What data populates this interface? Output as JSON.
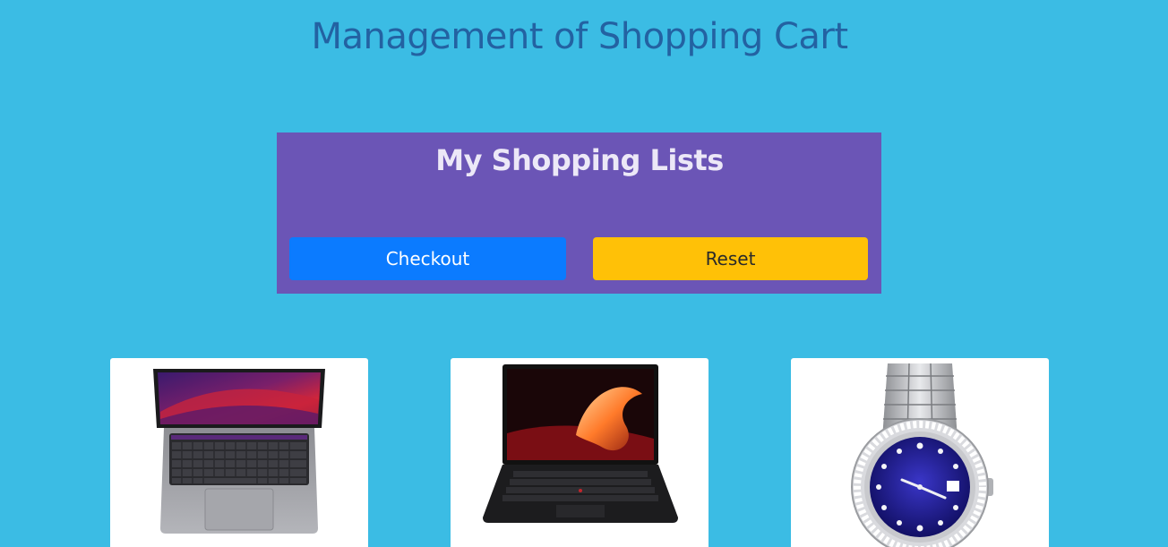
{
  "header": {
    "title": "Management of Shopping Cart"
  },
  "shopping_panel": {
    "title": "My Shopping Lists",
    "checkout_label": "Checkout",
    "reset_label": "Reset"
  },
  "products": [
    {
      "image": "macbook-laptop-image"
    },
    {
      "image": "black-laptop-image"
    },
    {
      "image": "rolex-watch-image"
    }
  ],
  "colors": {
    "background": "#3bbce4",
    "title": "#2362a2",
    "panel": "#6b55b6",
    "checkout": "#0b7bff",
    "reset": "#ffc107"
  }
}
